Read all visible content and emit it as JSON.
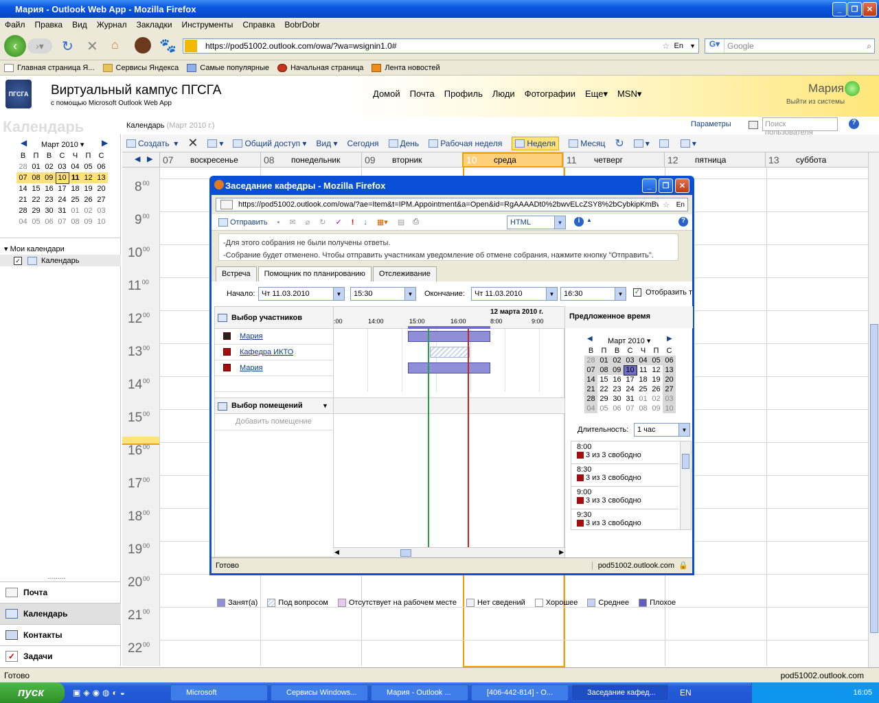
{
  "browser": {
    "title": "Мария - Outlook Web App - Mozilla Firefox",
    "menu": [
      "Файл",
      "Правка",
      "Вид",
      "Журнал",
      "Закладки",
      "Инструменты",
      "Справка",
      "BobrDobr"
    ],
    "url": "https://pod51002.outlook.com/owa/?wa=wsignin1.0#",
    "search_placeholder": "Google",
    "lang": "En"
  },
  "bookmarks": [
    "Главная страница Я...",
    "Сервисы Яндекса",
    "Самые популярные",
    "Начальная страница",
    "Лента новостей"
  ],
  "site": {
    "logo": "ПГСГА",
    "title": "Виртуальный кампус ПГСГА",
    "subtitle": "с помощью Microsoft Outlook Web App",
    "nav": [
      "Домой",
      "Почта",
      "Профиль",
      "Люди",
      "Фотографии",
      "Еще",
      "MSN"
    ],
    "user": "Мария",
    "signout": "Выйти из системы",
    "params": "Параметры",
    "search_users": "Поиск пользователя"
  },
  "calendar": {
    "watermark": "Календарь",
    "breadcrumb": "Календарь",
    "breadcrumb_hint": "(Март 2010 г.)",
    "toolbar": [
      "Создать",
      "Общий доступ",
      "Вид",
      "Сегодня",
      "День",
      "Рабочая неделя",
      "Неделя",
      "Месяц"
    ],
    "days": [
      {
        "n": "07",
        "name": "воскресенье"
      },
      {
        "n": "08",
        "name": "понедельник"
      },
      {
        "n": "09",
        "name": "вторник"
      },
      {
        "n": "10",
        "name": "среда"
      },
      {
        "n": "11",
        "name": "четверг"
      },
      {
        "n": "12",
        "name": "пятница"
      },
      {
        "n": "13",
        "name": "суббота"
      }
    ],
    "hours": [
      "8",
      "9",
      "10",
      "11",
      "12",
      "13",
      "14",
      "15",
      "16",
      "17",
      "18",
      "19",
      "20",
      "21",
      "22"
    ],
    "minutes": "00"
  },
  "minical": {
    "month": "Март 2010",
    "dow": [
      "В",
      "П",
      "В",
      "С",
      "Ч",
      "П",
      "С"
    ],
    "weeks": [
      [
        "28",
        "01",
        "02",
        "03",
        "04",
        "05",
        "06"
      ],
      [
        "07",
        "08",
        "09",
        "10",
        "11",
        "12",
        "13"
      ],
      [
        "14",
        "15",
        "16",
        "17",
        "18",
        "19",
        "20"
      ],
      [
        "21",
        "22",
        "23",
        "24",
        "25",
        "26",
        "27"
      ],
      [
        "28",
        "29",
        "30",
        "31",
        "01",
        "02",
        "03"
      ],
      [
        "04",
        "05",
        "06",
        "07",
        "08",
        "09",
        "10"
      ]
    ]
  },
  "sidebar": {
    "my_calendars": "Мои календари",
    "calendar": "Календарь",
    "nav": [
      "Почта",
      "Календарь",
      "Контакты",
      "Задачи"
    ]
  },
  "status": {
    "left": "Готово",
    "right": "pod51002.outlook.com"
  },
  "taskbar": {
    "start": "пуск",
    "tasks": [
      "Microsoft",
      "Сервисы Windows...",
      "Мария - Outlook ...",
      "[406-442-814] - О...",
      "Заседание кафед..."
    ],
    "lang": "EN",
    "time": "16:05"
  },
  "popup": {
    "title": "Заседание кафедры - Mozilla Firefox",
    "url": "https://pod51002.outlook.com/owa/?ae=Item&t=IPM.Appointment&a=Open&id=RgAAAADt0%2bwvELcZSY8%2bCybkipKmBw",
    "send": "Отправить",
    "format": "HTML",
    "info1": "-Для этого собрания не были получены ответы.",
    "info2": "-Собрание будет отменено. Чтобы отправить участникам уведомление об отмене собрания, нажмите кнопку \"Отправить\".",
    "tabs": [
      "Встреча",
      "Помощник по планированию",
      "Отслеживание"
    ],
    "start_label": "Начало:",
    "start_date": "Чт 11.03.2010",
    "start_time": "15:30",
    "end_label": "Окончание:",
    "end_date": "Чт 11.03.2010",
    "end_time": "16:30",
    "show_label": "Отобразить т",
    "attendees_title": "Выбор участников",
    "attendees": [
      "Мария",
      "Кафедра ИКТО",
      "Мария"
    ],
    "rooms_title": "Выбор помещений",
    "add_room": "Добавить помещение",
    "timeline": [
      ":00",
      "14:00",
      "15:00",
      "16:00",
      "8:00",
      "9:00"
    ],
    "next_date": "12 марта 2010 г.",
    "suggested_title": "Предложенное время",
    "pmonth": "Март 2010",
    "duration_label": "Длительность:",
    "duration": "1 час",
    "slots": [
      {
        "t": "8:00",
        "s": "3 из 3 свободно"
      },
      {
        "t": "8:30",
        "s": "3 из 3 свободно"
      },
      {
        "t": "9:00",
        "s": "3 из 3 свободно"
      },
      {
        "t": "9:30",
        "s": "3 из 3 свободно"
      }
    ],
    "legend": [
      "Занят(а)",
      "Под вопросом",
      "Отсутствует на рабочем месте",
      "Нет сведений",
      "Хорошее",
      "Среднее",
      "Плохое"
    ],
    "status_left": "Готово",
    "status_right": "pod51002.outlook.com"
  }
}
